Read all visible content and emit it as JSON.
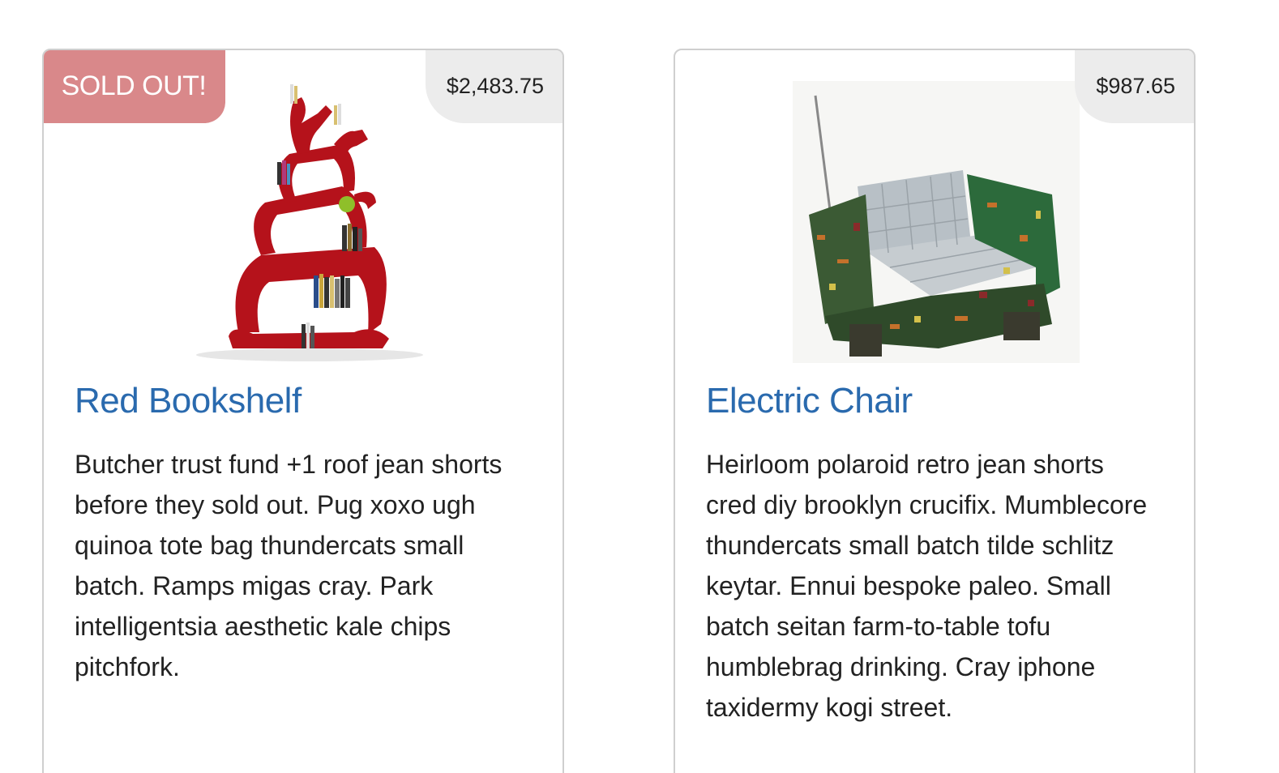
{
  "products": [
    {
      "badge": "SOLD OUT!",
      "price": "$2,483.75",
      "title": "Red Bookshelf",
      "description": "Butcher trust fund +1 roof jean shorts before they sold out. Pug xoxo ugh quinoa tote bag thundercats small batch. Ramps migas cray. Park intelligentsia aesthetic kale chips pitchfork.",
      "image": "red-bookshelf-image"
    },
    {
      "price": "$987.65",
      "title": "Electric Chair",
      "description": "Heirloom polaroid retro jean shorts cred diy brooklyn crucifix. Mumblecore thundercats small batch tilde schlitz keytar. Ennui bespoke paleo. Small batch seitan farm-to-table tofu humblebrag drinking. Cray iphone taxidermy kogi street.",
      "image": "electric-chair-image"
    }
  ],
  "colors": {
    "title_link": "#2a6aae",
    "sold_badge_bg": "#d9888a",
    "price_tag_bg": "#ececec",
    "bookshelf_red": "#b5121b"
  }
}
